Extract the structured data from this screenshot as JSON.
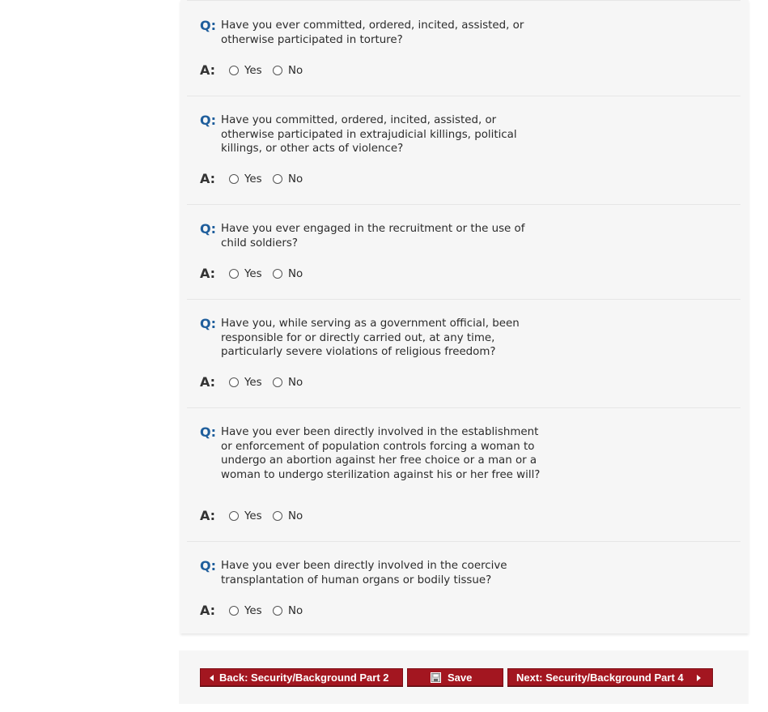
{
  "labels": {
    "question_marker": "Q:",
    "answer_marker": "A:"
  },
  "questions": [
    {
      "lines": [
        "Have you ever committed, ordered, incited, assisted, or",
        "otherwise participated in torture?"
      ],
      "options": [
        "Yes",
        "No"
      ]
    },
    {
      "lines": [
        "Have you committed, ordered, incited, assisted, or",
        "otherwise participated in extrajudicial killings, political",
        "killings, or other acts of violence?"
      ],
      "options": [
        "Yes",
        "No"
      ]
    },
    {
      "lines": [
        "Have you ever engaged in the recruitment or the use of",
        "child soldiers?"
      ],
      "options": [
        "Yes",
        "No"
      ]
    },
    {
      "lines": [
        "Have you, while serving as a government official, been",
        "responsible for or directly carried out, at any time,",
        "particularly severe violations of religious freedom?"
      ],
      "options": [
        "Yes",
        "No"
      ]
    },
    {
      "lines": [
        "Have you ever been directly involved in the establishment",
        "or enforcement of population controls forcing a woman to",
        "undergo an abortion against her free choice or a man or a",
        "woman to undergo sterilization against his or her free will?"
      ],
      "options": [
        "Yes",
        "No"
      ]
    },
    {
      "lines": [
        "Have you ever been directly involved in the coercive",
        "transplantation of human organs or bodily tissue?"
      ],
      "options": [
        "Yes",
        "No"
      ]
    }
  ],
  "footer": {
    "back_label": "Back: Security/Background Part 2",
    "save_label": "Save",
    "next_label": "Next: Security/Background Part 4"
  },
  "colors": {
    "question_marker": "#1f5e9c",
    "button_bg": "#a31620",
    "panel_bg": "#f6f6f6"
  },
  "icons": {
    "save": "floppy-disk-icon",
    "back": "arrow-left-icon",
    "next": "arrow-right-icon"
  }
}
